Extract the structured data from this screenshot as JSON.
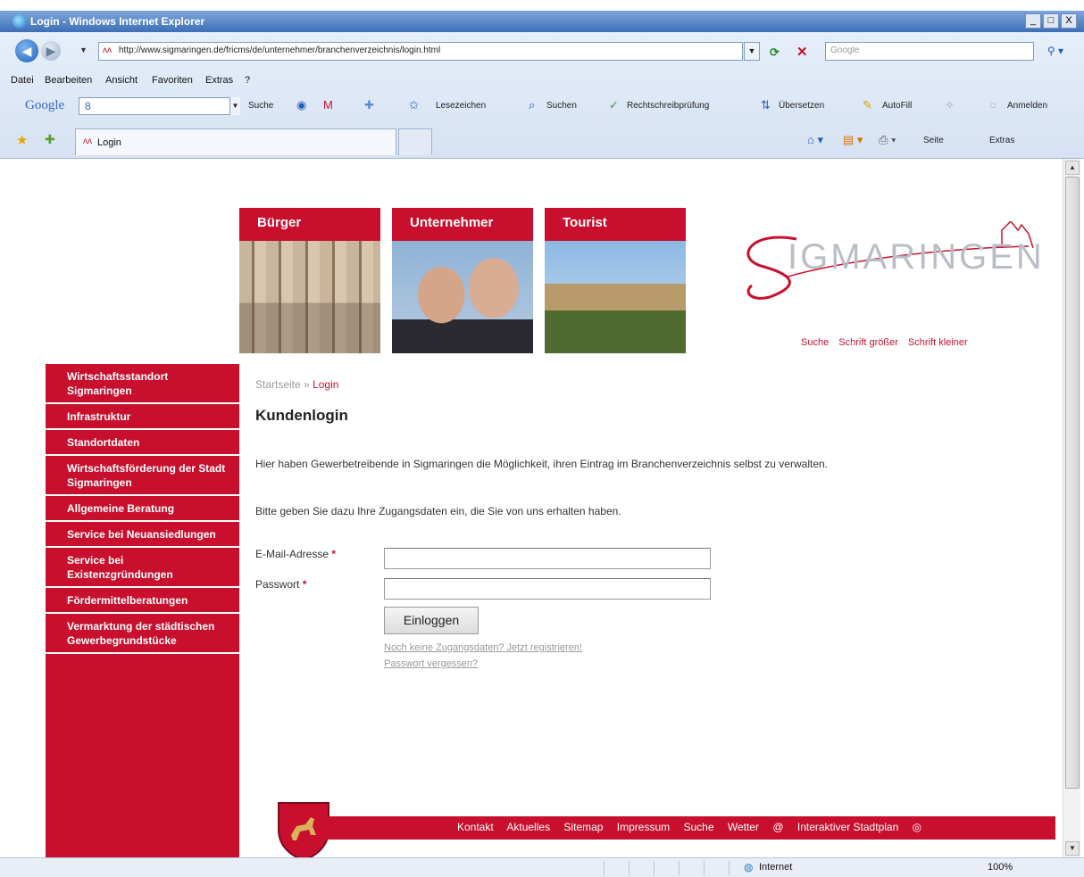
{
  "window": {
    "title": "Login - Windows Internet Explorer",
    "controls": [
      "_",
      "□",
      "X"
    ]
  },
  "addressbar": {
    "url": "http://www.sigmaringen.de/fricms/de/unternehmer/branchenverzeichnis/login.html",
    "search_placeholder": "Google"
  },
  "menu": [
    "Datei",
    "Bearbeiten",
    "Ansicht",
    "Favoriten",
    "Extras",
    "?"
  ],
  "google_toolbar": {
    "logo": "Google",
    "field": "8",
    "items": [
      "Suche",
      "Lesezeichen",
      "Suchen",
      "Rechtschreibprüfung",
      "Übersetzen",
      "AutoFill",
      "Anmelden"
    ]
  },
  "tabs": {
    "active": "Login",
    "commands": [
      "Seite",
      "Extras"
    ]
  },
  "site": {
    "nav_blocks": [
      "Bürger",
      "Unternehmer",
      "Tourist"
    ],
    "logo_text": "IGMARINGEN",
    "tools": [
      "Suche",
      "Schrift größer",
      "Schrift kleiner"
    ],
    "left_nav": [
      "Wirtschaftsstandort Sigmaringen",
      "Infrastruktur",
      "Standortdaten",
      "Wirtschaftsförderung der Stadt Sigmaringen",
      "Allgemeine Beratung",
      "Service bei Neuansiedlungen",
      "Service bei Existenzgründungen",
      "Fördermittelberatungen",
      "Vermarktung der städtischen Gewerbegrundstücke"
    ],
    "breadcrumb": {
      "home": "Startseite",
      "sep": "»",
      "current": "Login"
    },
    "heading": "Kundenlogin",
    "intro": "Hier haben Gewerbetreibende in Sigmaringen die Möglichkeit, ihren Eintrag im Branchenverzeichnis selbst zu verwalten.",
    "instruction": "Bitte geben Sie dazu Ihre Zugangsdaten ein, die Sie von uns erhalten haben.",
    "form": {
      "email_label": "E-Mail-Adresse",
      "password_label": "Passwort",
      "required_mark": "*",
      "email_value": "",
      "password_value": "",
      "submit": "Einloggen",
      "register_link": "Noch keine Zugangsdaten? Jetzt registrieren!",
      "forgot_link": "Passwort vergessen?"
    },
    "footer_links": [
      "Kontakt",
      "Aktuelles",
      "Sitemap",
      "Impressum",
      "Suche",
      "Wetter",
      "@",
      "Interaktiver Stadtplan"
    ]
  },
  "statusbar": {
    "zone": "Internet",
    "zoom": "100%"
  },
  "colors": {
    "brand_red": "#c8102e"
  }
}
